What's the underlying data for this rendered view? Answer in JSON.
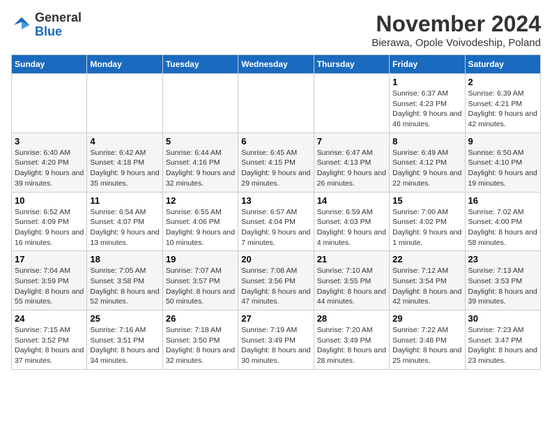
{
  "logo": {
    "general": "General",
    "blue": "Blue"
  },
  "title": "November 2024",
  "location": "Bierawa, Opole Voivodeship, Poland",
  "days_of_week": [
    "Sunday",
    "Monday",
    "Tuesday",
    "Wednesday",
    "Thursday",
    "Friday",
    "Saturday"
  ],
  "weeks": [
    [
      null,
      null,
      null,
      null,
      null,
      {
        "day": 1,
        "sunrise": "6:37 AM",
        "sunset": "4:23 PM",
        "daylight": "9 hours and 46 minutes."
      },
      {
        "day": 2,
        "sunrise": "6:39 AM",
        "sunset": "4:21 PM",
        "daylight": "9 hours and 42 minutes."
      }
    ],
    [
      {
        "day": 3,
        "sunrise": "6:40 AM",
        "sunset": "4:20 PM",
        "daylight": "9 hours and 39 minutes."
      },
      {
        "day": 4,
        "sunrise": "6:42 AM",
        "sunset": "4:18 PM",
        "daylight": "9 hours and 35 minutes."
      },
      {
        "day": 5,
        "sunrise": "6:44 AM",
        "sunset": "4:16 PM",
        "daylight": "9 hours and 32 minutes."
      },
      {
        "day": 6,
        "sunrise": "6:45 AM",
        "sunset": "4:15 PM",
        "daylight": "9 hours and 29 minutes."
      },
      {
        "day": 7,
        "sunrise": "6:47 AM",
        "sunset": "4:13 PM",
        "daylight": "9 hours and 26 minutes."
      },
      {
        "day": 8,
        "sunrise": "6:49 AM",
        "sunset": "4:12 PM",
        "daylight": "9 hours and 22 minutes."
      },
      {
        "day": 9,
        "sunrise": "6:50 AM",
        "sunset": "4:10 PM",
        "daylight": "9 hours and 19 minutes."
      }
    ],
    [
      {
        "day": 10,
        "sunrise": "6:52 AM",
        "sunset": "4:09 PM",
        "daylight": "9 hours and 16 minutes."
      },
      {
        "day": 11,
        "sunrise": "6:54 AM",
        "sunset": "4:07 PM",
        "daylight": "9 hours and 13 minutes."
      },
      {
        "day": 12,
        "sunrise": "6:55 AM",
        "sunset": "4:06 PM",
        "daylight": "9 hours and 10 minutes."
      },
      {
        "day": 13,
        "sunrise": "6:57 AM",
        "sunset": "4:04 PM",
        "daylight": "9 hours and 7 minutes."
      },
      {
        "day": 14,
        "sunrise": "6:59 AM",
        "sunset": "4:03 PM",
        "daylight": "9 hours and 4 minutes."
      },
      {
        "day": 15,
        "sunrise": "7:00 AM",
        "sunset": "4:02 PM",
        "daylight": "9 hours and 1 minute."
      },
      {
        "day": 16,
        "sunrise": "7:02 AM",
        "sunset": "4:00 PM",
        "daylight": "8 hours and 58 minutes."
      }
    ],
    [
      {
        "day": 17,
        "sunrise": "7:04 AM",
        "sunset": "3:59 PM",
        "daylight": "8 hours and 55 minutes."
      },
      {
        "day": 18,
        "sunrise": "7:05 AM",
        "sunset": "3:58 PM",
        "daylight": "8 hours and 52 minutes."
      },
      {
        "day": 19,
        "sunrise": "7:07 AM",
        "sunset": "3:57 PM",
        "daylight": "8 hours and 50 minutes."
      },
      {
        "day": 20,
        "sunrise": "7:08 AM",
        "sunset": "3:56 PM",
        "daylight": "8 hours and 47 minutes."
      },
      {
        "day": 21,
        "sunrise": "7:10 AM",
        "sunset": "3:55 PM",
        "daylight": "8 hours and 44 minutes."
      },
      {
        "day": 22,
        "sunrise": "7:12 AM",
        "sunset": "3:54 PM",
        "daylight": "8 hours and 42 minutes."
      },
      {
        "day": 23,
        "sunrise": "7:13 AM",
        "sunset": "3:53 PM",
        "daylight": "8 hours and 39 minutes."
      }
    ],
    [
      {
        "day": 24,
        "sunrise": "7:15 AM",
        "sunset": "3:52 PM",
        "daylight": "8 hours and 37 minutes."
      },
      {
        "day": 25,
        "sunrise": "7:16 AM",
        "sunset": "3:51 PM",
        "daylight": "8 hours and 34 minutes."
      },
      {
        "day": 26,
        "sunrise": "7:18 AM",
        "sunset": "3:50 PM",
        "daylight": "8 hours and 32 minutes."
      },
      {
        "day": 27,
        "sunrise": "7:19 AM",
        "sunset": "3:49 PM",
        "daylight": "8 hours and 30 minutes."
      },
      {
        "day": 28,
        "sunrise": "7:20 AM",
        "sunset": "3:49 PM",
        "daylight": "8 hours and 28 minutes."
      },
      {
        "day": 29,
        "sunrise": "7:22 AM",
        "sunset": "3:48 PM",
        "daylight": "8 hours and 25 minutes."
      },
      {
        "day": 30,
        "sunrise": "7:23 AM",
        "sunset": "3:47 PM",
        "daylight": "8 hours and 23 minutes."
      }
    ]
  ]
}
